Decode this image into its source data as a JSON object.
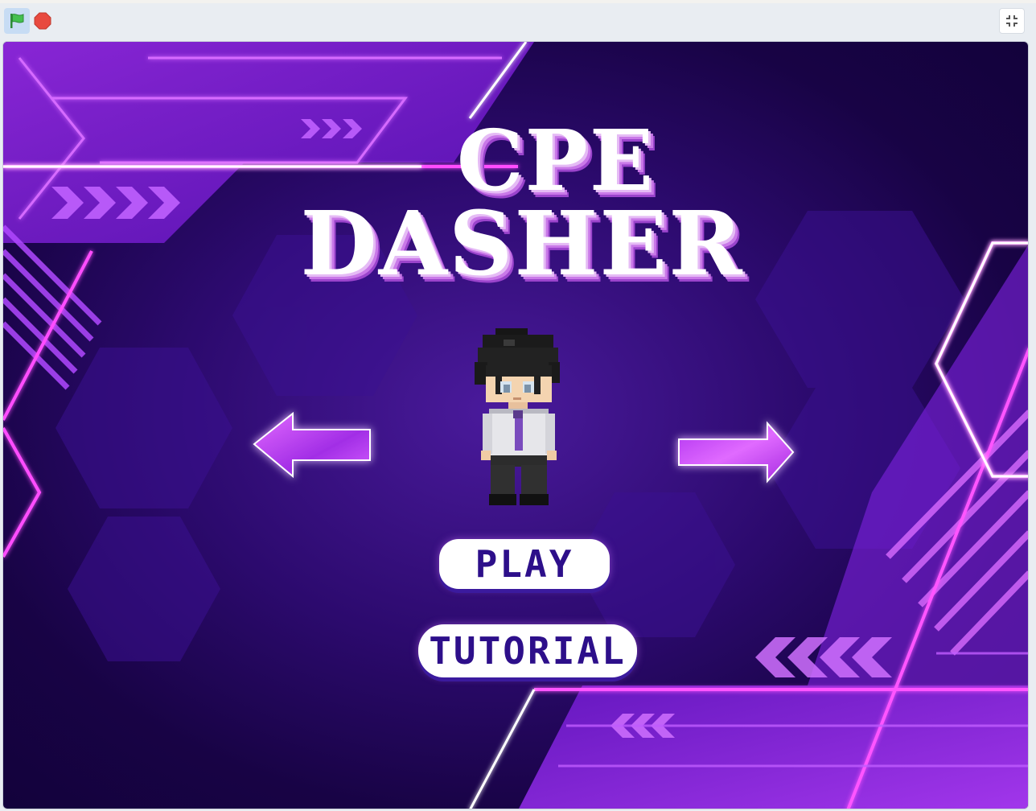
{
  "toolbar": {
    "green_flag_icon": "green-flag-icon",
    "stop_icon": "stop-sign-icon",
    "fullscreen_icon": "exit-fullscreen-icon"
  },
  "game": {
    "title_line1": "CPE",
    "title_line2": "DASHER",
    "play_label": "PLAY",
    "tutorial_label": "TUTORIAL",
    "left_arrow_icon": "left-arrow-icon",
    "right_arrow_icon": "right-arrow-icon"
  },
  "colors": {
    "background": "#1f055a",
    "accent": "#c040ff",
    "button_text": "#2d0f8a",
    "flag_green": "#3cb24a",
    "stop_red": "#e0463e"
  }
}
